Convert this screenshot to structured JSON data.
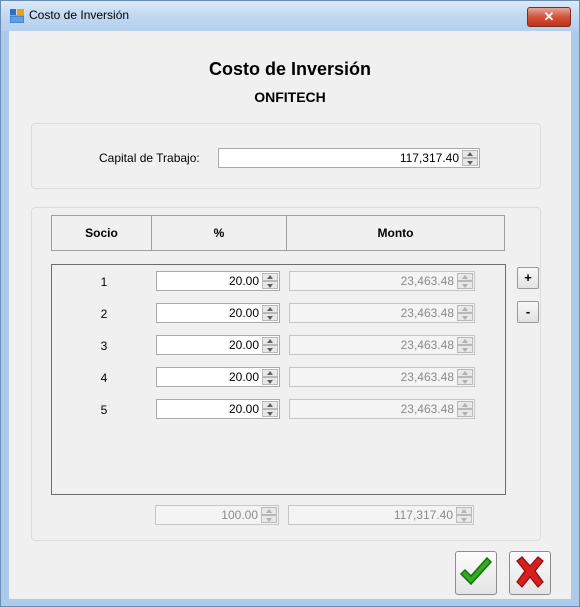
{
  "window": {
    "title": "Costo de Inversión",
    "close_glyph": "✕"
  },
  "header": {
    "title": "Costo de Inversión",
    "company": "ONFITECH"
  },
  "capital": {
    "label": "Capital de Trabajo:",
    "value": "117,317.40"
  },
  "table": {
    "columns": [
      "Socio",
      "%",
      "Monto"
    ],
    "rows": [
      {
        "socio": "1",
        "pct": "20.00",
        "monto": "23,463.48"
      },
      {
        "socio": "2",
        "pct": "20.00",
        "monto": "23,463.48"
      },
      {
        "socio": "3",
        "pct": "20.00",
        "monto": "23,463.48"
      },
      {
        "socio": "4",
        "pct": "20.00",
        "monto": "23,463.48"
      },
      {
        "socio": "5",
        "pct": "20.00",
        "monto": "23,463.48"
      }
    ],
    "totals": {
      "pct": "100.00",
      "monto": "117,317.40"
    }
  },
  "buttons": {
    "add": "+",
    "remove": "-"
  },
  "icons": {
    "window": "app-window-icon",
    "accept": "check-icon",
    "cancel": "x-icon"
  },
  "colors": {
    "accept": "#2fae1c",
    "cancel": "#d81e1e",
    "titlebar": "#c2d8f1"
  }
}
